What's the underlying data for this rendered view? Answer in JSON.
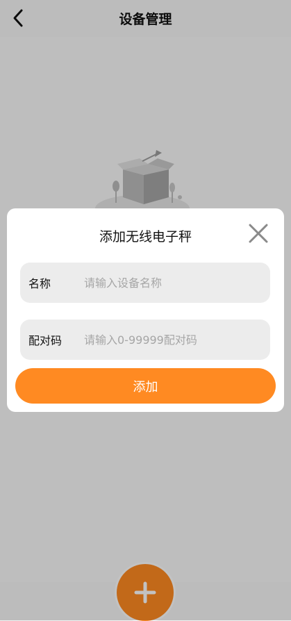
{
  "header": {
    "title": "设备管理",
    "back_icon": "chevron-left-icon"
  },
  "dialog": {
    "title": "添加无线电子秤",
    "close_icon": "close-icon",
    "fields": [
      {
        "label": "名称",
        "placeholder": "请输入设备名称",
        "value": ""
      },
      {
        "label": "配对码",
        "placeholder": "请输入0-99999配对码",
        "value": ""
      }
    ],
    "submit_label": "添加"
  },
  "empty_state": {
    "icon": "empty-box-icon"
  },
  "fab": {
    "icon": "plus-icon"
  },
  "colors": {
    "accent": "#ff8a22",
    "overlay": "rgba(0,0,0,0.24)",
    "field_bg": "#ececec"
  }
}
